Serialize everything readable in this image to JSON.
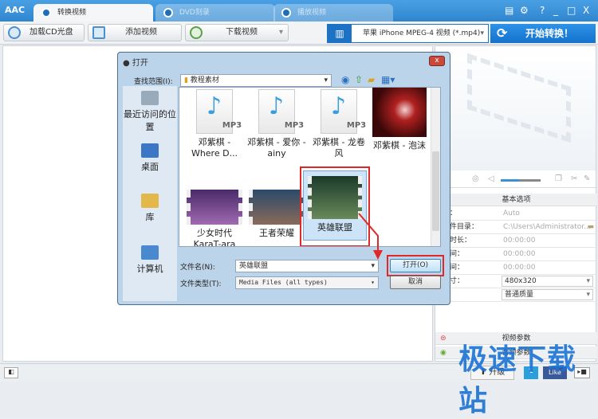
{
  "app": {
    "logo": "AAC"
  },
  "tabs": [
    {
      "label": "转换视频",
      "active": true
    },
    {
      "label": "DVD刻录",
      "active": false
    },
    {
      "label": "播放视频",
      "active": false
    }
  ],
  "window_controls": {
    "help": "?",
    "minimize": "_",
    "maximize": "□",
    "close": "X"
  },
  "toolbar": {
    "load_cd": "加载CD光盘",
    "add_video": "添加视频",
    "download_video": "下载视频",
    "profile": "苹果 iPhone MPEG-4 视频 (*.mp4)",
    "start": "开始转换！"
  },
  "dialog": {
    "title": "打开",
    "close": "x",
    "look_in_label": "查找范围(I):",
    "look_in_value": "教程素材",
    "places": [
      "最近访问的位置",
      "桌面",
      "库",
      "计算机"
    ],
    "files": [
      {
        "name": "邓紫棋 - Where D...",
        "type": "mp3"
      },
      {
        "name": "邓紫棋 - 爱你 - ainy",
        "type": "mp3"
      },
      {
        "name": "邓紫棋 - 龙卷风",
        "type": "mp3"
      },
      {
        "name": "邓紫棋 - 泡沫",
        "type": "video"
      },
      {
        "name": "少女时代 KaraT-ara",
        "type": "video"
      },
      {
        "name": "王者荣耀",
        "type": "video"
      },
      {
        "name": "英雄联盟",
        "type": "video",
        "selected": true
      }
    ],
    "filename_label": "文件名(N):",
    "filename_value": "英雄联盟",
    "filetype_label": "文件类型(T):",
    "filetype_value": "Media Files (all types)",
    "open_button": "打开(O)",
    "cancel_button": "取消",
    "highlight_color": "#e02828"
  },
  "right_panel": {
    "basic_options": "基本选项",
    "rows": [
      {
        "label": "件名：",
        "value": "Auto"
      },
      {
        "label": "出文件目录：",
        "value": "C:\\Users\\Administrator..."
      },
      {
        "label": "频总时长：",
        "value": "00:00:00"
      },
      {
        "label": "始时间：",
        "value": "00:00:00"
      },
      {
        "label": "束时间：",
        "value": "00:00:00"
      },
      {
        "label": "频尺寸：",
        "value": "480x320"
      },
      {
        "label": "量：",
        "value": "普通质量"
      }
    ],
    "video_params": "视频参数",
    "audio_params": "音频参数",
    "volume": 0.45
  },
  "bottom": {
    "upgrade": "升级",
    "like": "Like"
  },
  "watermark": "极速下载站"
}
